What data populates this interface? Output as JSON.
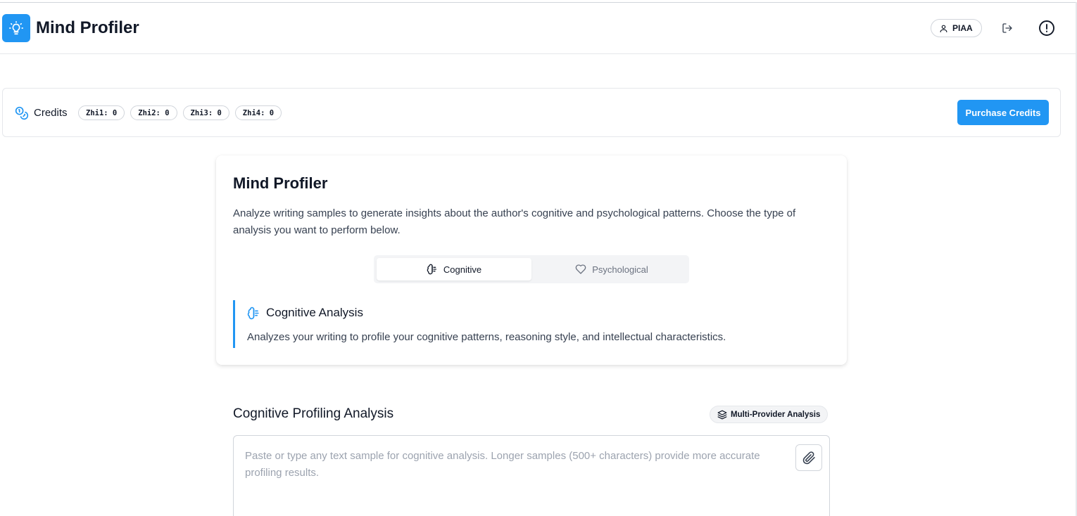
{
  "header": {
    "title": "Mind Profiler",
    "logo_icon": "lightbulb-icon",
    "user_label": "PIAA",
    "user_icon": "user-icon",
    "logout_icon": "logout-icon",
    "info_icon": "alert-circle-icon"
  },
  "credits": {
    "label": "Credits",
    "icon": "coins-icon",
    "badges": [
      "Zhi1: 0",
      "Zhi2: 0",
      "Zhi3: 0",
      "Zhi4: 0"
    ],
    "purchase_label": "Purchase Credits"
  },
  "card": {
    "title": "Mind Profiler",
    "description": "Analyze writing samples to generate insights about the author's cognitive and psychological patterns. Choose the type of analysis you want to perform below.",
    "tabs": [
      {
        "label": "Cognitive",
        "icon": "brain-icon",
        "active": true
      },
      {
        "label": "Psychological",
        "icon": "heart-icon",
        "active": false
      }
    ],
    "analysis": {
      "title": "Cognitive Analysis",
      "description": "Analyzes your writing to profile your cognitive patterns, reasoning style, and intellectual characteristics."
    }
  },
  "profiling": {
    "title": "Cognitive Profiling Analysis",
    "badge": "Multi-Provider Analysis",
    "input_value": "",
    "input_placeholder": "Paste or type any text sample for cognitive analysis. Longer samples (500+ characters) provide more accurate profiling results.",
    "attach_icon": "paperclip-icon"
  },
  "colors": {
    "accent": "#2196f3",
    "border": "#e5e7eb",
    "text": "#111827",
    "muted": "#374151",
    "placeholder": "#9ca3af"
  }
}
